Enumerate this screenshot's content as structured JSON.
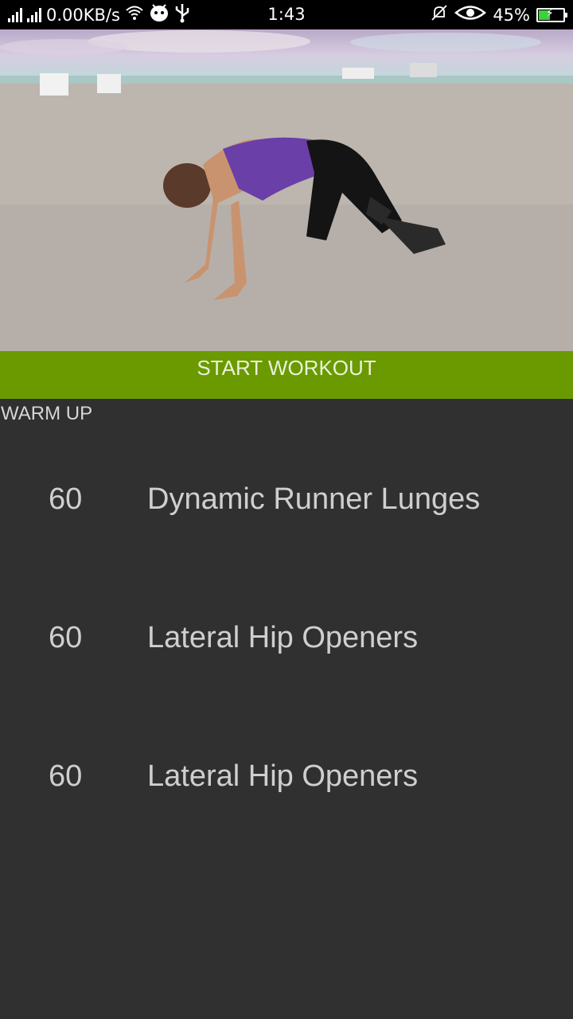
{
  "status_bar": {
    "network_speed": "0.00KB/s",
    "time": "1:43",
    "battery_percent": "45%",
    "battery_level": 0.45,
    "icons": [
      "signal-icon",
      "signal-icon",
      "wifi-icon",
      "android-icon",
      "usb-icon",
      "mute-icon",
      "eye-icon",
      "battery-icon"
    ]
  },
  "hero": {
    "image": "beach-workout-photo"
  },
  "start_button": {
    "label": "START WORKOUT",
    "color": "#6a9a00"
  },
  "section": {
    "title": "WARM UP"
  },
  "exercises": [
    {
      "seconds": "60",
      "name": "Dynamic Runner Lunges"
    },
    {
      "seconds": "60",
      "name": "Lateral Hip Openers"
    },
    {
      "seconds": "60",
      "name": "Lateral Hip Openers"
    }
  ],
  "colors": {
    "background": "#303030",
    "accent": "#6a9a00"
  }
}
